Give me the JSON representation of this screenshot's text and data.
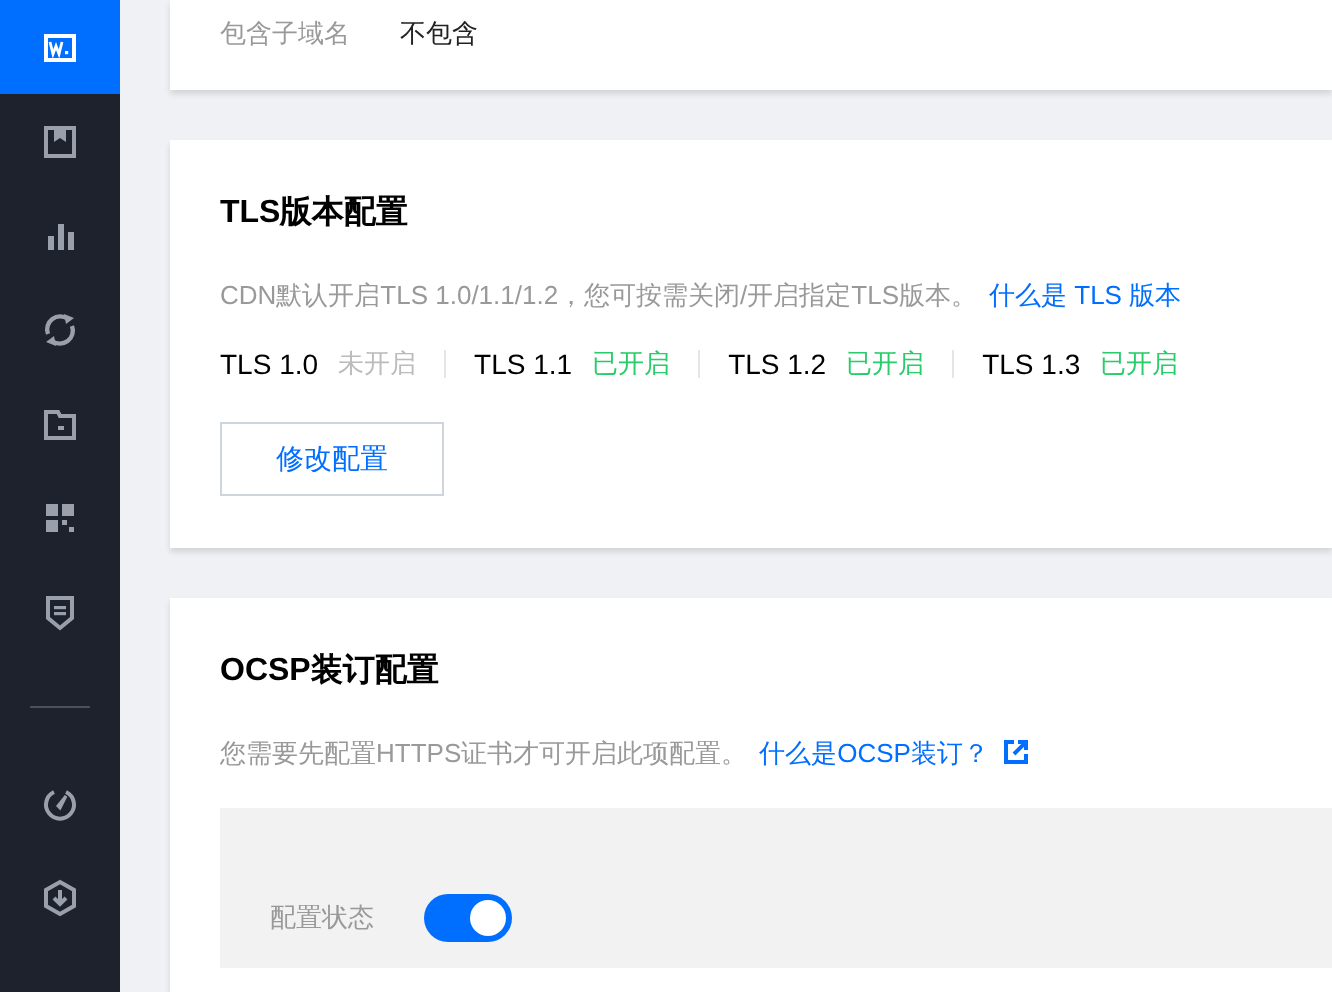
{
  "sidebar": {
    "items": [
      {
        "selected": true
      },
      {
        "selected": false
      },
      {
        "selected": false
      },
      {
        "selected": false
      },
      {
        "selected": false
      },
      {
        "selected": false
      },
      {
        "selected": false
      }
    ],
    "bottom_items": [
      {
        "selected": false
      },
      {
        "selected": false
      }
    ]
  },
  "domain_card": {
    "label": "包含子域名",
    "value": "不包含"
  },
  "tls_card": {
    "title": "TLS版本配置",
    "description": "CDN默认开启TLS 1.0/1.1/1.2，您可按需关闭/开启指定TLS版本。",
    "link": "什么是 TLS 版本",
    "versions": [
      {
        "name": "TLS 1.0",
        "status": "未开启",
        "on": false
      },
      {
        "name": "TLS 1.1",
        "status": "已开启",
        "on": true
      },
      {
        "name": "TLS 1.2",
        "status": "已开启",
        "on": true
      },
      {
        "name": "TLS 1.3",
        "status": "已开启",
        "on": true
      }
    ],
    "button": "修改配置"
  },
  "ocsp_card": {
    "title": "OCSP装订配置",
    "description": "您需要先配置HTTPS证书才可开启此项配置。",
    "link": "什么是OCSP装订？",
    "status_label": "配置状态",
    "on": true
  }
}
